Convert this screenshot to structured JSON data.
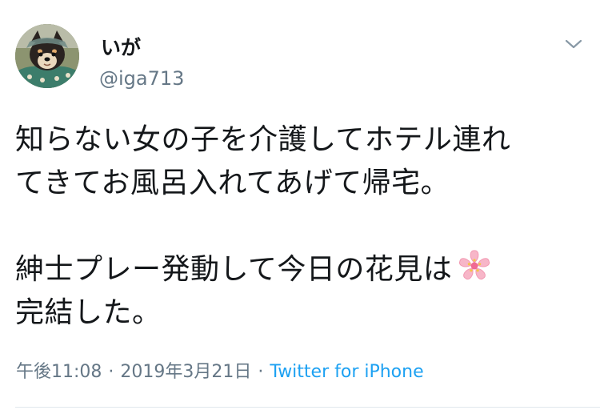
{
  "user": {
    "display_name": "いが",
    "handle": "@iga713",
    "avatar_icon": "shiba-dog-avatar"
  },
  "menu": {
    "icon": "chevron-down-icon"
  },
  "tweet": {
    "lines": [
      "知らない女の子を介護してホテル連れ",
      "てきてお風呂入れてあげて帰宅。",
      "",
      "紳士プレー発動して今日の花見は",
      "完結した。"
    ],
    "emoji": "cherry-blossom-icon"
  },
  "meta": {
    "time": "午後11:08",
    "separator": "·",
    "date": "2019年3月21日",
    "source": "Twitter for iPhone"
  },
  "colors": {
    "text": "#14171a",
    "secondary": "#657786",
    "link": "#1da1f2",
    "divider": "#e1e8ed"
  }
}
